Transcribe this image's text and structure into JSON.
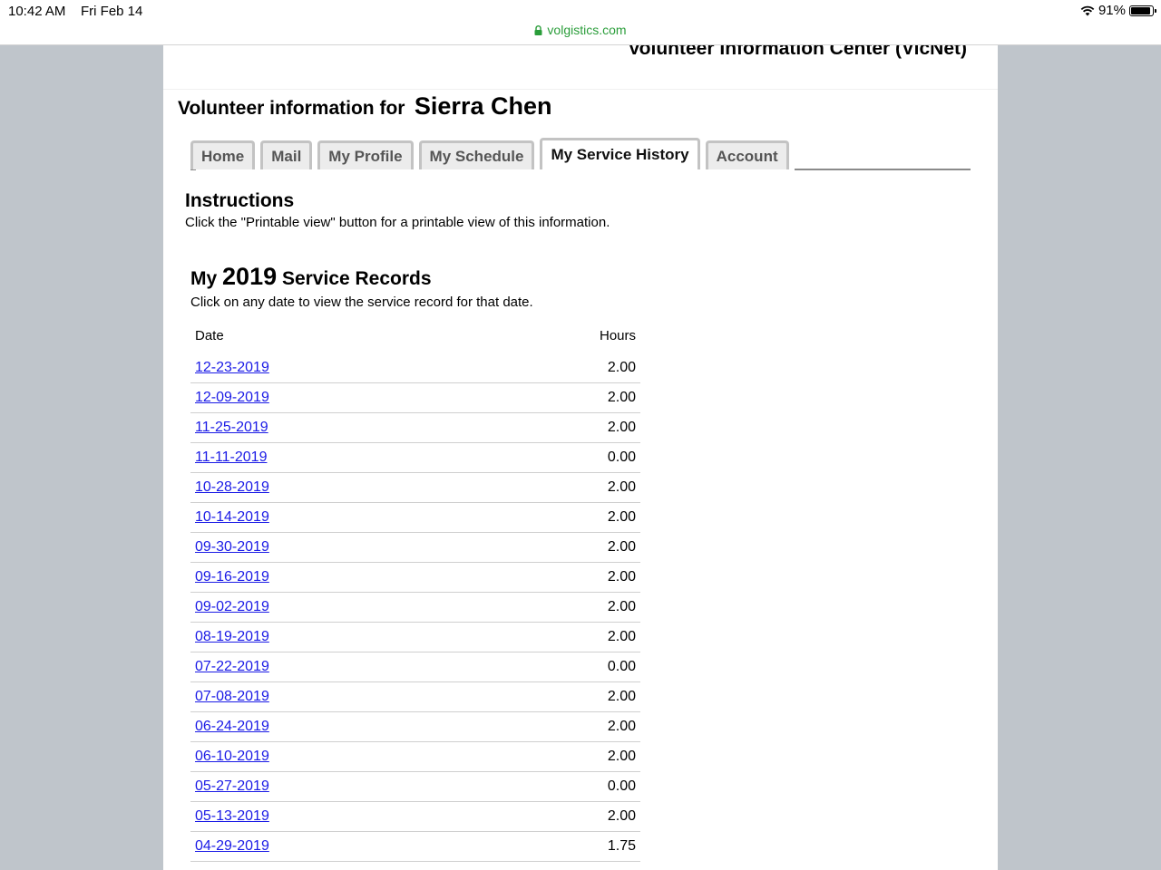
{
  "status_bar": {
    "time": "10:42 AM",
    "date": "Fri Feb 14",
    "battery": "91%"
  },
  "browser": {
    "url": "volgistics.com"
  },
  "site": {
    "title": "Volunteer Information Center (VicNet)"
  },
  "volunteer": {
    "label": "Volunteer information for",
    "name": "Sierra Chen"
  },
  "tabs": [
    {
      "label": "Home",
      "active": false
    },
    {
      "label": "Mail",
      "active": false
    },
    {
      "label": "My Profile",
      "active": false
    },
    {
      "label": "My Schedule",
      "active": false
    },
    {
      "label": "My Service History",
      "active": true
    },
    {
      "label": "Account",
      "active": false
    }
  ],
  "instructions": {
    "heading": "Instructions",
    "text": "Click the \"Printable view\" button for a printable view of this information."
  },
  "records": {
    "heading_prefix": "My",
    "year": "2019",
    "heading_suffix": "Service Records",
    "subtitle": "Click on any date to view the service record for that date.",
    "columns": {
      "date": "Date",
      "hours": "Hours"
    },
    "rows": [
      {
        "date": "12-23-2019",
        "hours": "2.00"
      },
      {
        "date": "12-09-2019",
        "hours": "2.00"
      },
      {
        "date": "11-25-2019",
        "hours": "2.00"
      },
      {
        "date": "11-11-2019",
        "hours": "0.00"
      },
      {
        "date": "10-28-2019",
        "hours": "2.00"
      },
      {
        "date": "10-14-2019",
        "hours": "2.00"
      },
      {
        "date": "09-30-2019",
        "hours": "2.00"
      },
      {
        "date": "09-16-2019",
        "hours": "2.00"
      },
      {
        "date": "09-02-2019",
        "hours": "2.00"
      },
      {
        "date": "08-19-2019",
        "hours": "2.00"
      },
      {
        "date": "07-22-2019",
        "hours": "0.00"
      },
      {
        "date": "07-08-2019",
        "hours": "2.00"
      },
      {
        "date": "06-24-2019",
        "hours": "2.00"
      },
      {
        "date": "06-10-2019",
        "hours": "2.00"
      },
      {
        "date": "05-27-2019",
        "hours": "0.00"
      },
      {
        "date": "05-13-2019",
        "hours": "2.00"
      },
      {
        "date": "04-29-2019",
        "hours": "1.75"
      }
    ]
  }
}
